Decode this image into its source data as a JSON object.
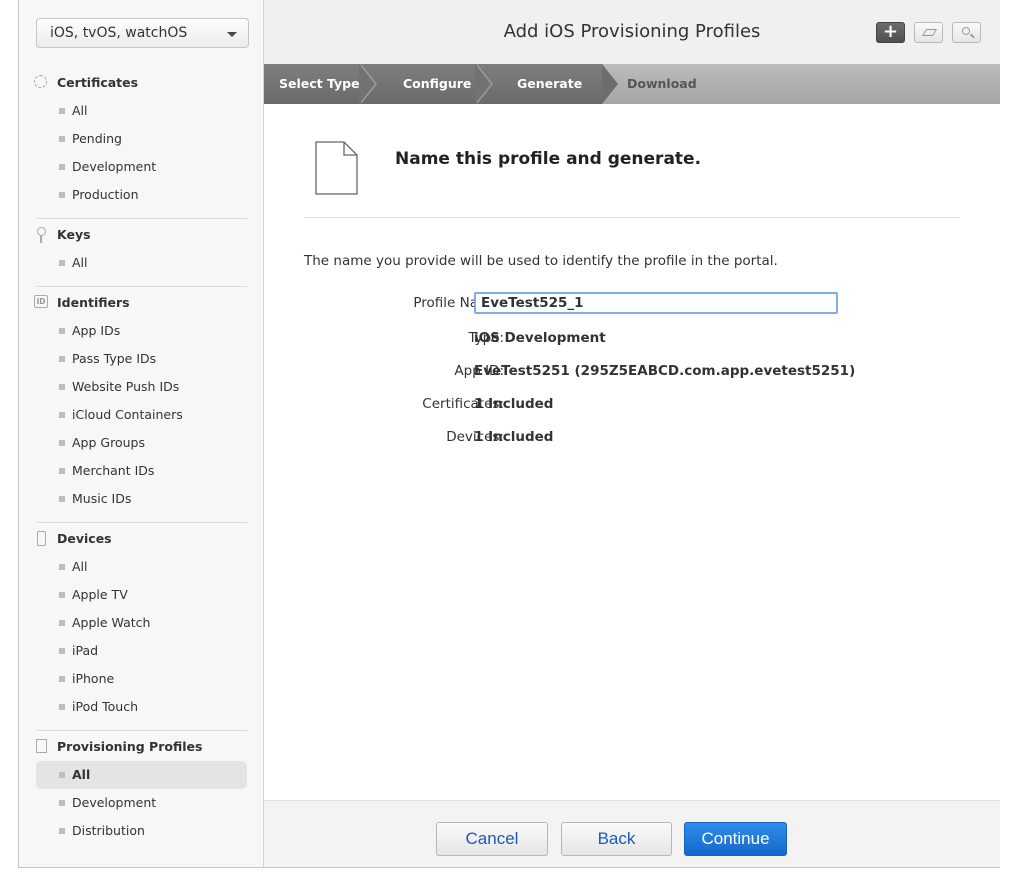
{
  "platform_selector": {
    "value": "iOS, tvOS, watchOS"
  },
  "sidebar": {
    "certificates": {
      "title": "Certificates",
      "items": [
        "All",
        "Pending",
        "Development",
        "Production"
      ]
    },
    "keys": {
      "title": "Keys",
      "items": [
        "All"
      ]
    },
    "identifiers": {
      "title": "Identifiers",
      "icon_text": "ID",
      "items": [
        "App IDs",
        "Pass Type IDs",
        "Website Push IDs",
        "iCloud Containers",
        "App Groups",
        "Merchant IDs",
        "Music IDs"
      ]
    },
    "devices": {
      "title": "Devices",
      "items": [
        "All",
        "Apple TV",
        "Apple Watch",
        "iPad",
        "iPhone",
        "iPod Touch"
      ]
    },
    "provisioning_profiles": {
      "title": "Provisioning Profiles",
      "items": [
        "All",
        "Development",
        "Distribution"
      ],
      "selected": "All"
    }
  },
  "header": {
    "title": "Add iOS Provisioning Profiles",
    "add_icon": "plus-icon",
    "edit_icon": "pencil-icon",
    "search_icon": "magnifier-icon"
  },
  "steps": [
    "Select Type",
    "Configure",
    "Generate",
    "Download"
  ],
  "current_step": "Generate",
  "content": {
    "heading": "Name this profile and generate.",
    "description": "The name you provide will be used to identify the profile in the portal.",
    "profile_name_label": "Profile Name:",
    "profile_name_value": "EveTest525_1",
    "type_label": "Type:",
    "type_value": "iOS Development",
    "app_id_label": "App ID:",
    "app_id_value": "EveTest5251 (295Z5EABCD.com.app.evetest5251)",
    "certificates_label": "Certificates:",
    "certificates_value": "1 Included",
    "devices_label": "Devices:",
    "devices_value": "1 Included"
  },
  "footer": {
    "cancel": "Cancel",
    "back": "Back",
    "continue": "Continue"
  },
  "colors": {
    "primary_button": "#1c72d8",
    "step_done": "#727272",
    "step_pending": "#a9a9a9",
    "input_focus": "#7eaee6"
  }
}
